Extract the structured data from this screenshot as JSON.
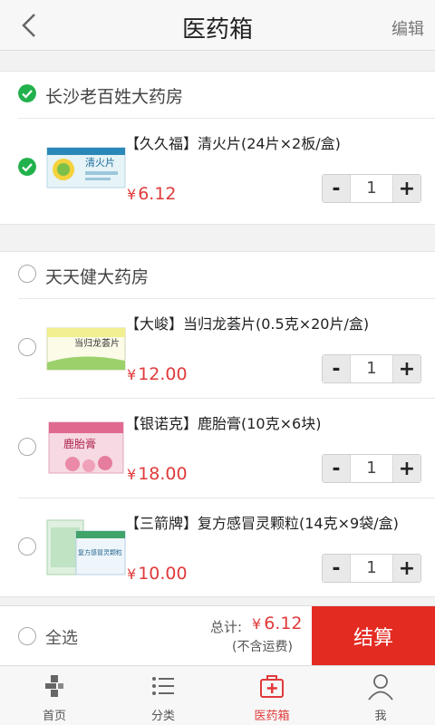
{
  "header": {
    "title": "医药箱",
    "edit_label": "编辑"
  },
  "stores": [
    {
      "name": "长沙老百姓大药房",
      "checked": true,
      "items": [
        {
          "name": "【久久福】清火片(24片×2板/盒)",
          "price": "6.12",
          "qty": "1",
          "checked": true,
          "box_text": "清火片"
        }
      ]
    },
    {
      "name": "天天健大药房",
      "checked": false,
      "items": [
        {
          "name": "【大峻】当归龙荟片(0.5克×20片/盒)",
          "price": "12.00",
          "qty": "1",
          "checked": false,
          "box_text": "当归龙荟片"
        },
        {
          "name": "【银诺克】鹿胎膏(10克×6块)",
          "price": "18.00",
          "qty": "1",
          "checked": false,
          "box_text": "鹿胎膏"
        },
        {
          "name": "【三箭牌】复方感冒灵颗粒(14克×9袋/盒)",
          "price": "10.00",
          "qty": "1",
          "checked": false,
          "box_text": "复方感冒灵颗粒"
        }
      ]
    }
  ],
  "currency": "¥",
  "stepper": {
    "minus": "-",
    "plus": "+"
  },
  "checkout": {
    "select_all_label": "全选",
    "total_label": "总计:",
    "total_amount": "6.12",
    "shipping_note": "(不含运费)",
    "pay_label": "结算"
  },
  "tabs": [
    {
      "label": "首页",
      "icon": "home-icon",
      "active": false
    },
    {
      "label": "分类",
      "icon": "category-list-icon",
      "active": false
    },
    {
      "label": "医药箱",
      "icon": "medicine-box-icon",
      "active": true
    },
    {
      "label": "我",
      "icon": "user-icon",
      "active": false
    }
  ],
  "colors": {
    "accent": "#e32b22",
    "price": "#e03a3a",
    "check": "#22b14c"
  }
}
